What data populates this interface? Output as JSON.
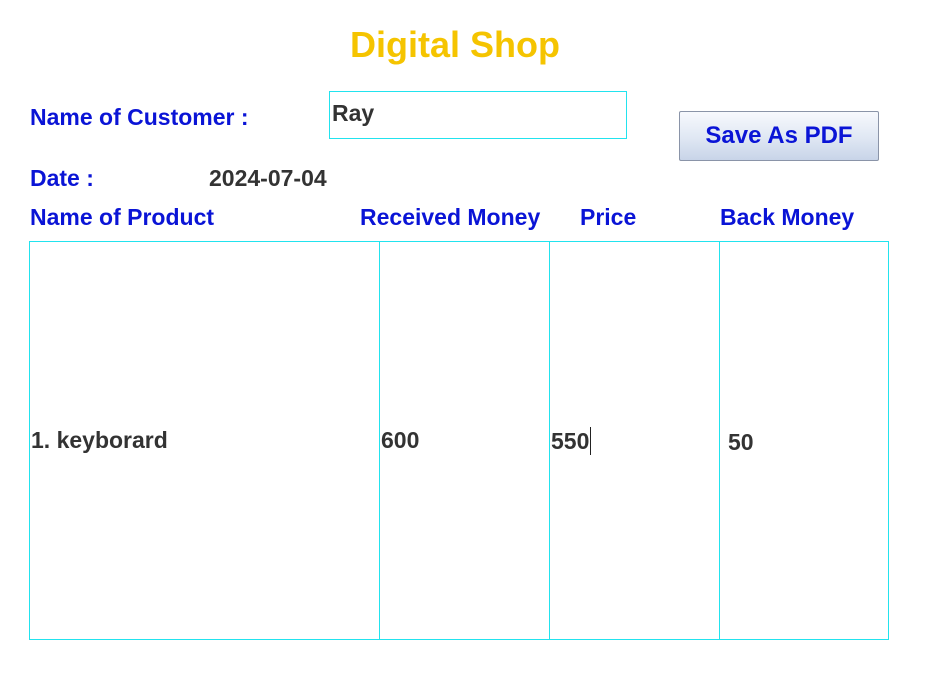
{
  "app": {
    "title": "Digital Shop"
  },
  "customer": {
    "label": "Name of Customer :",
    "value": "Ray"
  },
  "actions": {
    "save_pdf_label": "Save As PDF"
  },
  "date": {
    "label": "Date :",
    "value": "2024-07-04"
  },
  "table": {
    "headers": {
      "product": "Name of Product",
      "received": "Received Money",
      "price": "Price",
      "back": "Back Money"
    },
    "row": {
      "product": "1. keyborard",
      "received": "600",
      "price": "550",
      "back": "50"
    }
  },
  "colors": {
    "title": "#f5c400",
    "label": "#0a14d6",
    "border": "#22e3ee",
    "text": "#333333"
  }
}
